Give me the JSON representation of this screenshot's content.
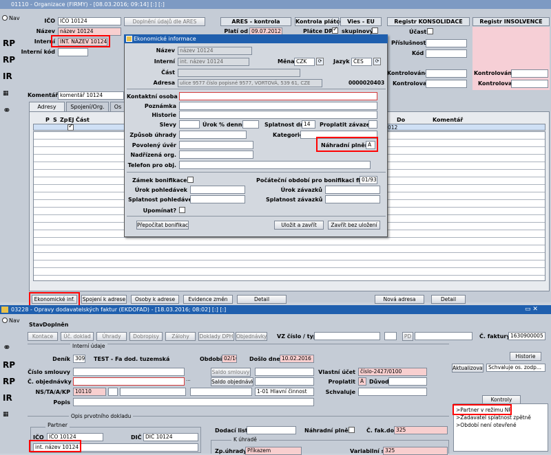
{
  "top": {
    "title": "01110 - Organizace (FIRMY) - [08.03.2016; 09:14] [:] [:]",
    "nav_label": "Nav",
    "ico_label": "IČO",
    "ico_value": "IČO 10124",
    "nazev_label": "Název",
    "nazev_value": "název 10124",
    "interni_label": "Interní",
    "interni_value": "INT. NÁZEV 10124",
    "interni_kod_label": "Interní kód",
    "doplneni_button": "Doplnění údajů dle ARES",
    "ares_header": "ARES - kontrola",
    "plati_od_label": "Platí od",
    "plati_od_value": "09.07.2012",
    "kontrola_header": "Kontrola plátce",
    "vies_header": "Vies - EU",
    "platce_dph_label": "Plátce DPH",
    "skupinovy_label": "skupinový",
    "reg_konsolidace_header": "Registr KONSOLIDACE",
    "reg_insolvence_header": "Registr INSOLVENCE",
    "ucast_label": "Účast",
    "prislusnost_label": "Příslušnost",
    "kod_label": "Kód",
    "kontrolovano_label": "Kontrolováno",
    "kontroloval_label": "Kontroloval",
    "komentar_label": "Komentář:",
    "komentar_value": "komentář 10124",
    "tabs": [
      "Adresy",
      "Spojení/Org.",
      "Os"
    ],
    "grid_headers": [
      "P",
      "S",
      "Zp",
      "EJ",
      "Část"
    ],
    "grid_right_headers": [
      "Do",
      "Komentář"
    ],
    "grid_partial_value": "012",
    "buttons": [
      "Ekonomické inf.",
      "Spojení k adrese",
      "Osoby k adrese",
      "Evidence změn",
      "Detail",
      "Nová adresa",
      "Detail"
    ]
  },
  "popup": {
    "title": "Ekonomické informace",
    "nazev_label": "Název",
    "nazev_value": "název 10124",
    "interni_label": "Interní",
    "interni_value": "int. název 10124",
    "mena_label": "Měna",
    "mena_value": "CZK",
    "jazyk_label": "Jazyk",
    "jazyk_value": "ČES",
    "cast_label": "Část",
    "adresa_label": "Adresa",
    "adresa_value": "ulice 9577 číslo popisné 9577, VORTOVÁ, 539 61, CZE",
    "adresa_code": "0000020403",
    "kontaktni_label": "Kontaktní osoba",
    "poznamka_label": "Poznámka",
    "historie_label": "Historie",
    "slevy_label": "Slevy",
    "urok_denne_label": "Úrok % denně",
    "splatnost_dni_label": "Splatnost dní",
    "splatnost_dni_value": "14",
    "proplatit_label": "Proplatit závazek",
    "zpusob_label": "Způsob úhrady",
    "kategorie_label": "Kategorie",
    "povoleny_label": "Povolený úvěr",
    "nahradni_label": "Náhradní plnění",
    "nahradni_value": "A",
    "nadrizena_label": "Nadřízená org.",
    "telefon_label": "Telefon pro obj.",
    "zamek_label": "Zámek bonifikace?",
    "pocatecni_label": "Počáteční období pro bonifikaci firem",
    "pocatecni_value": "01/93",
    "urok_pohl_label": "Úrok pohledávek",
    "urok_zav_label": "Úrok závazků",
    "spl_pohl_label": "Splatnost pohledávek",
    "spl_zav_label": "Splatnost závazků",
    "upominat_label": "Upomínat?",
    "prepocitat_button": "Přepočítat bonifikaci",
    "ulozit_button": "Uložit a zavřít",
    "zavrit_button": "Zavřít bez uložení"
  },
  "bottom": {
    "title": "03228 - Opravy dodavatelských faktur (EKDOFAD) - [18.03.2016; 08:02] [:] [:]",
    "nav_label": "Nav",
    "stav_label": "Stav",
    "stav_value": "Doplněn",
    "toolbar": [
      "Kontace",
      "Úč. doklad",
      "Úhrady",
      "Dobropisy",
      "Zálohy",
      "Doklady DPH",
      "Objednávky"
    ],
    "vz_label": "VZ číslo / typ",
    "pd_label": "PD",
    "c_faktury_label": "Č. faktury",
    "c_faktury_value": "1630900005",
    "interni_udaje": "Interní údaje",
    "historie_button": "Historie",
    "denik_label": "Deník",
    "denik_value": "309",
    "denik_text": "TEST - Fa dod. tuzemská",
    "obdobi_label": "Období",
    "obdobi_value": "02/16",
    "doslo_label": "Došlo dne",
    "doslo_value": "10.02.2016",
    "cislo_smlouvy_label": "Číslo smlouvy",
    "saldo_smlouvy_button": "Saldo smlouvy",
    "vlastni_ucet_label": "Vlastní účet",
    "vlastni_ucet_value": "číslo-2427/0100",
    "aktualizovat_button": "Aktualizovat",
    "schvaluje_value": "Schvaluje os. zodp...",
    "c_objednavky_label": "Č. objednávky",
    "saldo_objednavky_button": "Saldo objednávky",
    "proplatit_label": "Proplatit",
    "proplatit_value": "A",
    "duvod_label": "Důvod",
    "ns_label": "NS/TA/A/KP",
    "ns_value": "10110",
    "cinnost_value": "1-01 Hlavní činnost",
    "schvaluje_label": "Schvaluje",
    "popis_label": "Popis",
    "kontroly_button": "Kontroly",
    "kontroly_items": [
      ">Partner v režimu NP",
      ">Zadavatel splatnost zpětně",
      ">Období není otevřené"
    ],
    "opis_label": "Opis prvotního dokladu",
    "partner_label": "Partner",
    "ico_label": "IČO",
    "ico_value": "IČO 10124",
    "dic_label": "DIČ",
    "dic_value": "DIČ 10124",
    "partner_name": "int. název 10124",
    "dodaci_label": "Dodací list",
    "nahradni_label": "Náhradní plnění",
    "c_fak_dod_label": "Č. fak.dod",
    "c_fak_dod_value": "325",
    "k_uhrade_label": "K úhradě",
    "zp_uhrady_label": "Zp.úhrady",
    "zp_uhrady_value": "Příkazem",
    "variabilni_label": "Variabilní s.",
    "variabilni_value": "325"
  },
  "colors": {
    "title_active": "#1f5fae",
    "required_pink": "#f8cfcf",
    "highlight": "#ff0000"
  }
}
